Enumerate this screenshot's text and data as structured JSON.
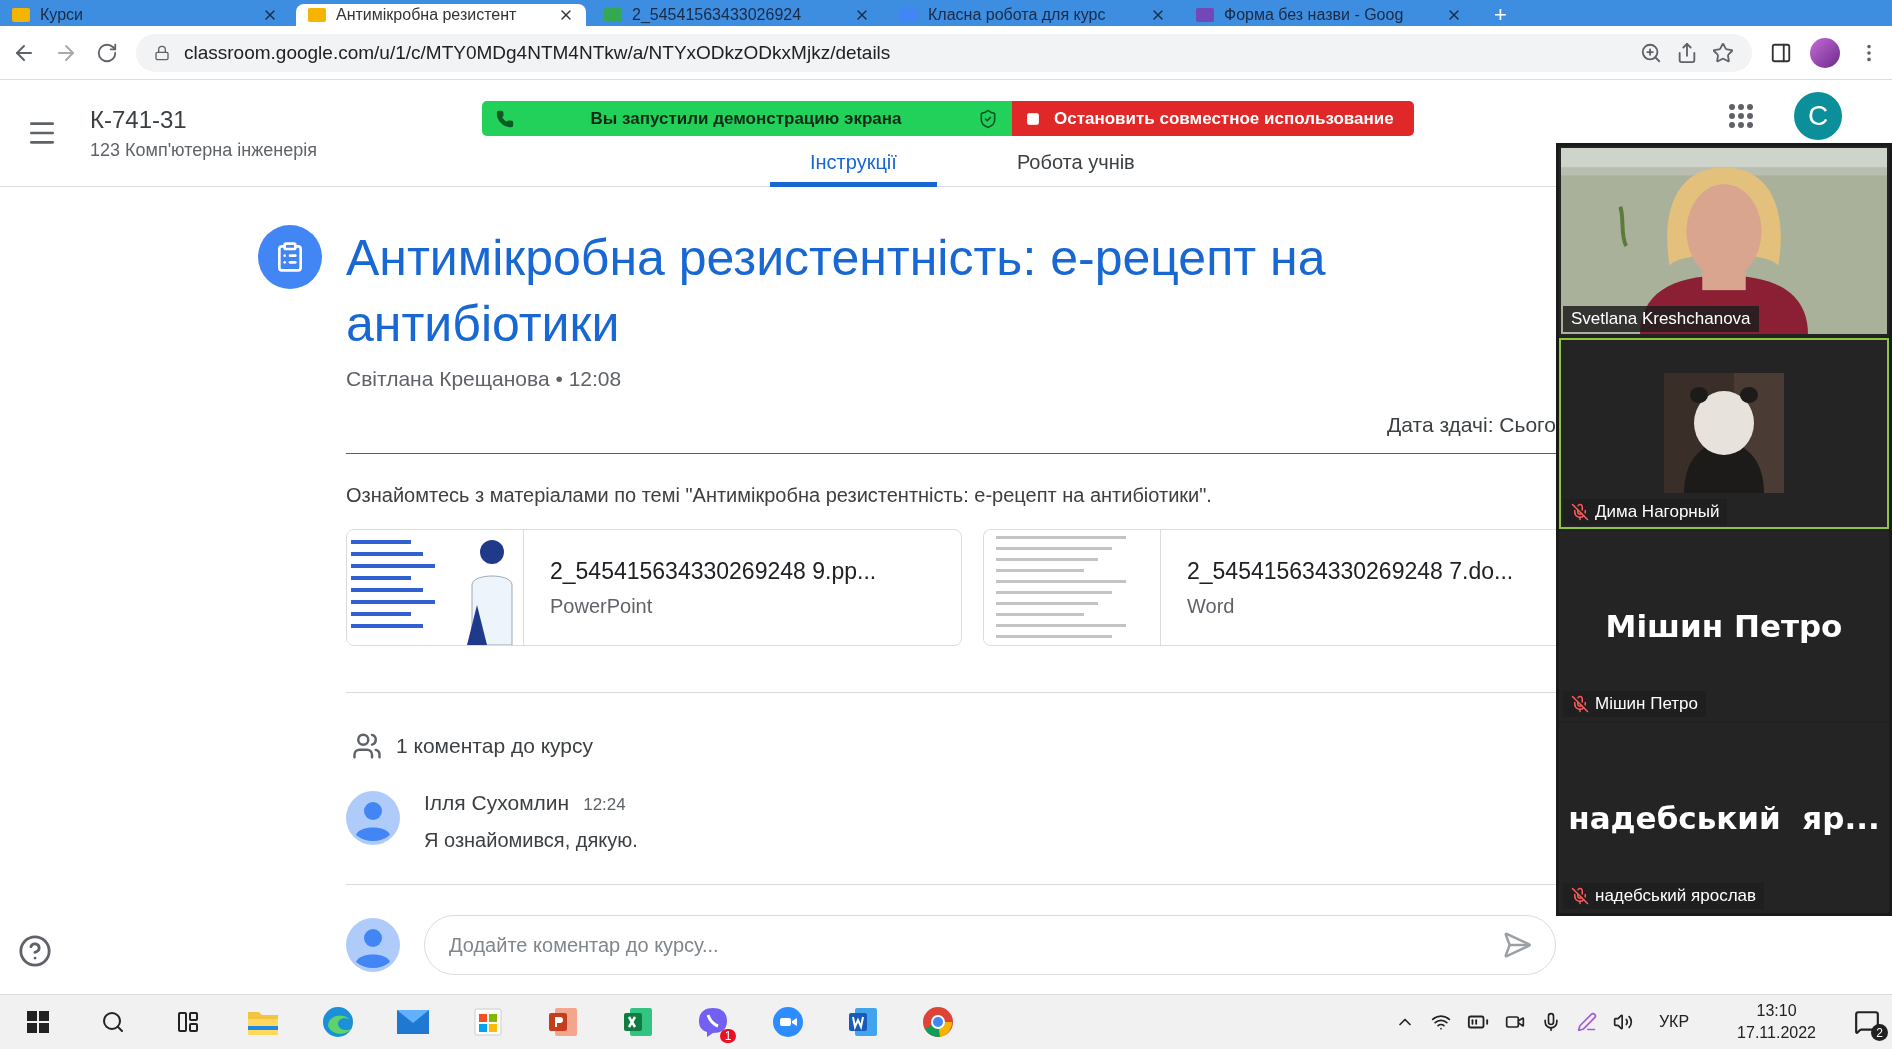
{
  "browser": {
    "tabs": [
      {
        "title": "Курси",
        "selected": false
      },
      {
        "title": "Антимікробна резистент",
        "selected": true
      },
      {
        "title": "2_54541563433026924",
        "selected": false
      },
      {
        "title": "Класна робота для курс",
        "selected": false
      },
      {
        "title": "Форма без назви - Goog",
        "selected": false
      }
    ],
    "new_tab": "+",
    "url": "classroom.google.com/u/1/c/MTY0MDg4NTM4NTkw/a/NTYxODkzODkxMjkz/details"
  },
  "screen_share_banner": {
    "message": "Вы запустили демонстрацию экрана",
    "stop_button": "Остановить совместное использование"
  },
  "header": {
    "class_name": "К-741-31",
    "subject": "123 Комп'ютерна інженерія",
    "tabs": [
      {
        "label": "Інструкції",
        "selected": true
      },
      {
        "label": "Робота учнів",
        "selected": false
      }
    ],
    "avatar": "C"
  },
  "assignment": {
    "title": "Антимікробна резистентність: е-рецепт на антибіотики",
    "meta": "Світлана Крещанова • 12:08",
    "due": "Дата здачі: Сього",
    "description": "Ознайомтесь з матеріалами по темі \"Антимікробна резистентність: е-рецепт на антибіотики\".",
    "attachments": [
      {
        "name": "2_545415634330269248 9.pp...",
        "type": "PowerPoint",
        "kind": "slides"
      },
      {
        "name": "2_545415634330269248 7.do...",
        "type": "Word",
        "kind": "document"
      }
    ]
  },
  "comments": {
    "heading": "1 коментар до курсу",
    "items": [
      {
        "author": "Ілля Сухомлин",
        "time": "12:24",
        "text": "Я ознайомився, дякую."
      }
    ],
    "placeholder": "Додайте коментар до курсу..."
  },
  "meeting": {
    "participants": [
      {
        "name": "Svetlana Kreshchanova",
        "kind": "video",
        "muted": false,
        "speaking": false
      },
      {
        "name": "Дима Нагорный",
        "kind": "avatar",
        "muted": true,
        "speaking": true
      },
      {
        "name": "Мішин Петро",
        "kind": "name",
        "display": "Мішин Петро",
        "muted": true,
        "speaking": false
      },
      {
        "name": "надебський ярослав",
        "kind": "name",
        "display": "надебський  яр...",
        "muted": true,
        "speaking": false
      }
    ]
  },
  "taskbar": {
    "apps": [
      {
        "kind": "files"
      },
      {
        "kind": "edge"
      },
      {
        "kind": "mail"
      },
      {
        "kind": "store"
      },
      {
        "kind": "powerpoint"
      },
      {
        "kind": "excel"
      },
      {
        "kind": "viber",
        "badge": "1"
      },
      {
        "kind": "zoom"
      },
      {
        "kind": "word"
      },
      {
        "kind": "chrome"
      }
    ],
    "language": "УКР",
    "time": "13:10",
    "date": "17.11.2022",
    "notifications": "2"
  }
}
